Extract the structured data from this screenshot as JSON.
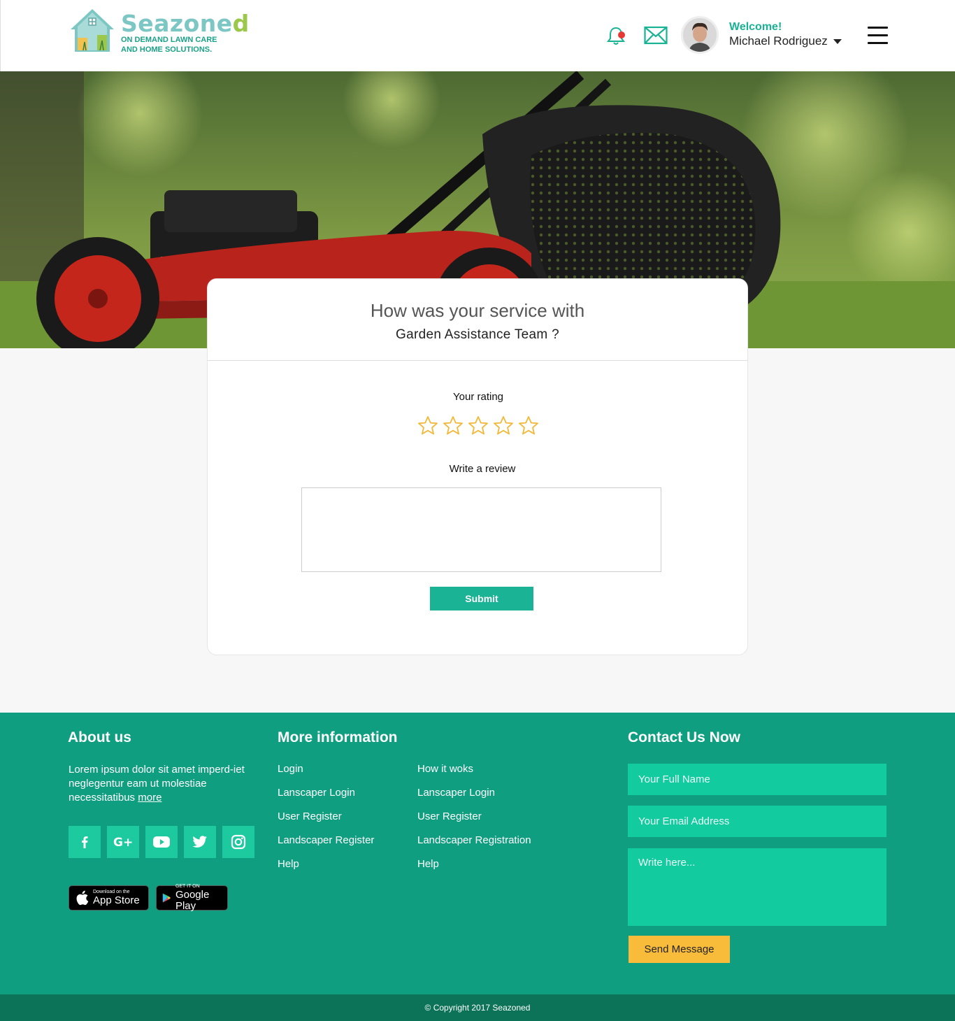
{
  "brand": {
    "name_main": "Seazone",
    "name_end": "d",
    "tagline_1": "ON DEMAND LAWN CARE",
    "tagline_2": "AND HOME SOLUTIONS."
  },
  "header": {
    "welcome": "Welcome!",
    "user_name": "Michael Rodriguez",
    "notification_icon": "bell-icon",
    "mail_icon": "mail-icon",
    "menu_icon": "hamburger-icon",
    "accent_color": "#19b394",
    "notification_dot_color": "#e53935"
  },
  "review": {
    "question": "How was your service with",
    "team": "Garden Assistance Team ?",
    "rating_label": "Your rating",
    "rating_value": 0,
    "rating_max": 5,
    "review_label": "Write a review",
    "review_value": "",
    "submit_label": "Submit",
    "star_color": "#f2b83a"
  },
  "footer": {
    "about": {
      "heading": "About us",
      "text": "Lorem ipsum dolor sit amet imperd-iet neglegentur eam ut molestiae necessitatibus ",
      "more": "more",
      "socials": [
        "facebook-icon",
        "google-plus-icon",
        "youtube-icon",
        "twitter-icon",
        "instagram-icon"
      ],
      "app_store_small": "Download on the",
      "app_store_big": "App Store",
      "google_play_small": "GET IT ON",
      "google_play_big": "Google Play"
    },
    "more_info": {
      "heading": "More information",
      "col1": [
        "Login",
        "Lanscaper Login",
        "User Register",
        "Landscaper Register",
        "Help"
      ],
      "col2": [
        "How it woks",
        "Lanscaper Login",
        "User Register",
        "Landscaper Registration",
        "Help"
      ]
    },
    "contact": {
      "heading": "Contact Us Now",
      "name_placeholder": "Your Full Name",
      "email_placeholder": "Your Email Address",
      "message_placeholder": "Write here...",
      "send_label": "Send Message"
    },
    "copyright": "© Copyright 2017 Seazoned",
    "colors": {
      "footer_bg": "#0f9f80",
      "input_bg": "#12cb9f",
      "send_bg": "#f8bb3a",
      "bar_bg": "#0c7358"
    }
  }
}
